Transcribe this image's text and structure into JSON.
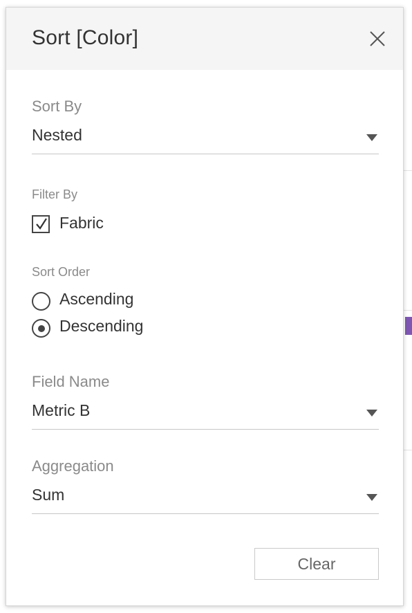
{
  "dialog": {
    "title": "Sort [Color]"
  },
  "sort_by": {
    "label": "Sort By",
    "value": "Nested"
  },
  "filter_by": {
    "label": "Filter By",
    "option_label": "Fabric",
    "checked": true
  },
  "sort_order": {
    "label": "Sort Order",
    "options": [
      {
        "label": "Ascending",
        "selected": false
      },
      {
        "label": "Descending",
        "selected": true
      }
    ]
  },
  "field_name": {
    "label": "Field Name",
    "value": "Metric B"
  },
  "aggregation": {
    "label": "Aggregation",
    "value": "Sum"
  },
  "actions": {
    "clear_label": "Clear"
  },
  "colors": {
    "header_bg": "#f5f5f5",
    "text": "#333333",
    "muted_label": "#8a8a8a",
    "background_accent": "#7e57b3"
  }
}
